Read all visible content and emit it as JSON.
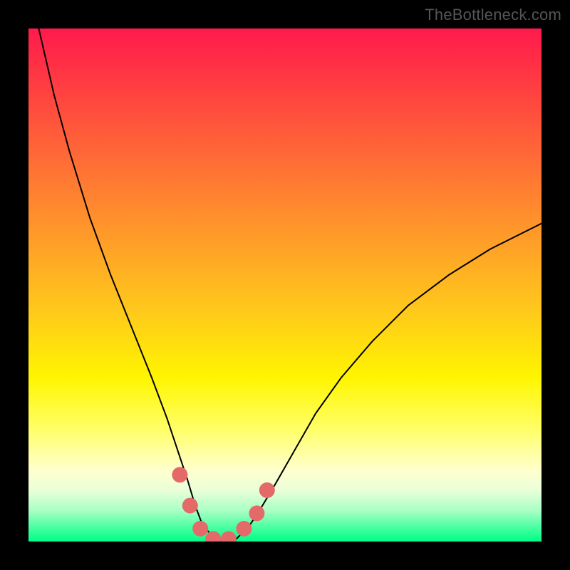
{
  "watermark": "TheBottleneck.com",
  "chart_data": {
    "type": "line",
    "title": "",
    "xlabel": "",
    "ylabel": "",
    "xlim": [
      0,
      100
    ],
    "ylim": [
      0,
      100
    ],
    "grid": false,
    "legend": false,
    "series": [
      {
        "name": "curve",
        "color": "#000000",
        "stroke_width": 2,
        "x": [
          0,
          2,
          5,
          8,
          12,
          16,
          20,
          24,
          27,
          29,
          31,
          32.5,
          34,
          36,
          38,
          40,
          41,
          43,
          45,
          48,
          52,
          56,
          61,
          67,
          74,
          82,
          90,
          100
        ],
        "y": [
          110,
          100,
          87,
          76,
          63,
          52,
          42,
          32,
          24,
          18,
          12,
          7,
          3,
          1,
          0,
          0,
          1,
          3,
          6,
          11,
          18,
          25,
          32,
          39,
          46,
          52,
          57,
          62
        ]
      },
      {
        "name": "markers",
        "color": "#e46a6a",
        "type": "scatter",
        "marker_radius": 11,
        "x": [
          29.5,
          31.5,
          33.5,
          36.0,
          39.0,
          42.0,
          44.5,
          46.5
        ],
        "y": [
          13.0,
          7.0,
          2.5,
          0.5,
          0.5,
          2.5,
          5.5,
          10.0
        ]
      }
    ],
    "background_gradient": {
      "direction": "top-to-bottom",
      "stops": [
        {
          "pos": 0.0,
          "color": "#ff1a4d"
        },
        {
          "pos": 0.2,
          "color": "#ff5a3a"
        },
        {
          "pos": 0.44,
          "color": "#ffa626"
        },
        {
          "pos": 0.68,
          "color": "#fff500"
        },
        {
          "pos": 0.86,
          "color": "#ffffcc"
        },
        {
          "pos": 0.94,
          "color": "#a8ffc4"
        },
        {
          "pos": 1.0,
          "color": "#00ff88"
        }
      ]
    }
  }
}
